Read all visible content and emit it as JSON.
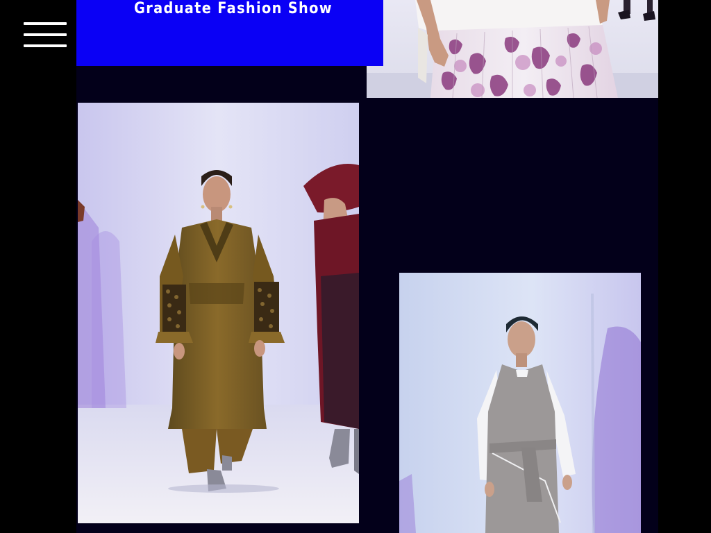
{
  "header": {
    "title": "Graduate Fashion Show",
    "menu_icon": "hamburger-menu-icon"
  },
  "colors": {
    "page_background": "#000000",
    "content_background": "#03001a",
    "banner_background": "#0a00f5",
    "title_text": "#ffffff"
  },
  "gallery": {
    "photos": [
      {
        "name": "runway-photo-floral-skirt"
      },
      {
        "name": "runway-photo-olive-coat"
      },
      {
        "name": "runway-photo-grey-apron-dress"
      }
    ]
  }
}
